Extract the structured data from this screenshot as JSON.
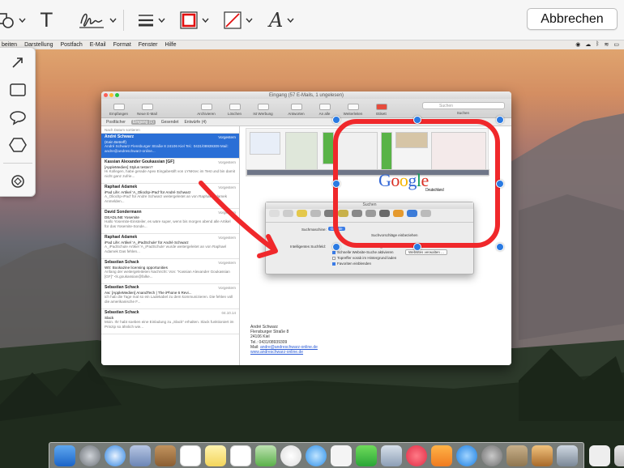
{
  "markup_toolbar": {
    "text_tool_glyph": "T",
    "font_tool_glyph": "A",
    "cancel_label": "Abbrechen",
    "border_color": "#e11010",
    "tools": [
      "shapes",
      "text",
      "signature",
      "line-style",
      "border-color",
      "fill-color",
      "font"
    ]
  },
  "menubar": {
    "items": [
      "beiten",
      "Darstellung",
      "Postfach",
      "E-Mail",
      "Format",
      "Fenster",
      "Hilfe"
    ]
  },
  "shapes_palette": {
    "items": [
      "arrow",
      "rectangle",
      "speech-bubble",
      "hexagon",
      "loupe"
    ]
  },
  "mail_window": {
    "title": "Eingang (57 E-Mails, 1 ungelesen)",
    "toolbar": [
      "Empfangen",
      "Neue E-Mail",
      "Archivieren",
      "Löschen",
      "Ist Werbung",
      "Antworten",
      "An alle",
      "Weiterleiten",
      "Etikett"
    ],
    "search_placeholder": "Suchen",
    "search_caption": "Suchen",
    "favorites": [
      "Postfächer",
      "Eingang (1)",
      "Gesendet",
      "Entwürfe (4)"
    ],
    "sort_label": "Nach Datum sortieren",
    "messages": [
      {
        "from": "André Schwarz",
        "date": "Vorgestern",
        "subject": "(Kein Betreff)",
        "preview": "André Schwarz Flensburger Straße 8 24106 Kiel Tel.: 0431/08939309 Mail: andre@andreschwarz-online...",
        "selected": true
      },
      {
        "from": "Kassian Alexander Goukassian [GF]",
        "date": "Vorgestern",
        "subject": "[AppleMedien] Stylus testen?",
        "preview": "Hi Kollegen, habe gerade Apex Eingabestift von LYNKtec im Test und bin damit nicht ganz zufrie...",
        "selected": false
      },
      {
        "from": "Raphael Adamek",
        "date": "Vorgestern",
        "subject": "iPad Life: Artikel 'A_OlioclIp-iPad' für André Schwarz",
        "preview": "A_OlioclIp-iPad' für Andre Schwarz weitergeleitet an von Raphael Adamek Anmelden...",
        "selected": false
      },
      {
        "from": "David Sondermann",
        "date": "Vorgestern",
        "subject": "DEADLINE Yosemite",
        "preview": "Hallo Yosemite-Einsteiler, es wäre super, wenn bis morgen abend alle Artikel für das Yosemite-Sonde...",
        "selected": false
      },
      {
        "from": "Raphael Adamek",
        "date": "Vorgestern",
        "subject": "iPad Life: Artikel 'A_iPadSchule' für André Schwarz",
        "preview": "A_iPadSchule Artikel 'A_iPadSchule' wurde weitergeleitet an von Raphael Adamek Das fehlen...",
        "selected": false
      },
      {
        "from": "Sebastian Schack",
        "date": "Vorgestern",
        "subject": "Wtr: Bookazine licensing opportunities",
        "preview": "Anfang der weitergeleiteten Nachricht: Von: \"Kassian Alexander Goukassian [GF]\" <k.goukassian@falke...",
        "selected": false
      },
      {
        "from": "Sebastian Schack",
        "date": "Vorgestern",
        "subject": "Aw: [AppleMedien] AnandTech | The iPhone 6 Revi...",
        "preview": "ich hab die Tage mal so ein Ladekabel zu dem kommunizieren. Die fehlen voll die amerikanische F...",
        "selected": false
      },
      {
        "from": "Sebastian Schack",
        "date": "04.10.14",
        "subject": "Slack",
        "preview": "Moin. Ihr habt soeben eine Einladung zu „Slack\" erhalten. Slack funktioniert im Prinzip so ähnlich wie...",
        "selected": false
      }
    ],
    "google_subtitle": "Deutschland",
    "prefs": {
      "title": "Suchen",
      "search_engine_label": "Suchmaschine:",
      "search_engine_value": "Google",
      "smart_search_label": "Intelligentes Suchfeld:",
      "option1": "Vorschläge einbeziehen",
      "option2": "Schnelle Website-Suche aktivieren",
      "option2_button": "Websites verwalten ...",
      "option3": "Topreffer vorab im Hintergrund laden",
      "option4": "Favoriten einblenden",
      "option0": "Suchvorschläge einbeziehen"
    },
    "signature": {
      "name": "André Schwarz",
      "street": "Flensburger Straße 8",
      "city": "24106 Kiel",
      "phone": "Tel.: 0431/08939309",
      "mail_label": "Mail:",
      "mail": "andre@andreschwarz-online.de",
      "web": "www.andreschwarz-online.de"
    }
  },
  "colors": {
    "annotation_red": "#f0282b",
    "handle_blue": "#2a7ae2",
    "selection_blue": "#2a6fd6"
  }
}
